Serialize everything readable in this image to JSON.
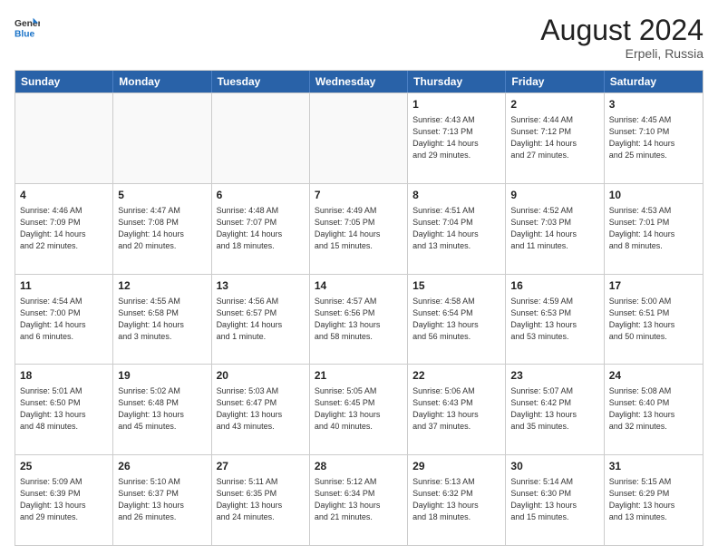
{
  "header": {
    "logo_line1": "General",
    "logo_line2": "Blue",
    "month": "August 2024",
    "location": "Erpeli, Russia"
  },
  "weekdays": [
    "Sunday",
    "Monday",
    "Tuesday",
    "Wednesday",
    "Thursday",
    "Friday",
    "Saturday"
  ],
  "rows": [
    [
      {
        "day": "",
        "text": "",
        "empty": true
      },
      {
        "day": "",
        "text": "",
        "empty": true
      },
      {
        "day": "",
        "text": "",
        "empty": true
      },
      {
        "day": "",
        "text": "",
        "empty": true
      },
      {
        "day": "1",
        "text": "Sunrise: 4:43 AM\nSunset: 7:13 PM\nDaylight: 14 hours\nand 29 minutes.",
        "empty": false
      },
      {
        "day": "2",
        "text": "Sunrise: 4:44 AM\nSunset: 7:12 PM\nDaylight: 14 hours\nand 27 minutes.",
        "empty": false
      },
      {
        "day": "3",
        "text": "Sunrise: 4:45 AM\nSunset: 7:10 PM\nDaylight: 14 hours\nand 25 minutes.",
        "empty": false
      }
    ],
    [
      {
        "day": "4",
        "text": "Sunrise: 4:46 AM\nSunset: 7:09 PM\nDaylight: 14 hours\nand 22 minutes.",
        "empty": false
      },
      {
        "day": "5",
        "text": "Sunrise: 4:47 AM\nSunset: 7:08 PM\nDaylight: 14 hours\nand 20 minutes.",
        "empty": false
      },
      {
        "day": "6",
        "text": "Sunrise: 4:48 AM\nSunset: 7:07 PM\nDaylight: 14 hours\nand 18 minutes.",
        "empty": false
      },
      {
        "day": "7",
        "text": "Sunrise: 4:49 AM\nSunset: 7:05 PM\nDaylight: 14 hours\nand 15 minutes.",
        "empty": false
      },
      {
        "day": "8",
        "text": "Sunrise: 4:51 AM\nSunset: 7:04 PM\nDaylight: 14 hours\nand 13 minutes.",
        "empty": false
      },
      {
        "day": "9",
        "text": "Sunrise: 4:52 AM\nSunset: 7:03 PM\nDaylight: 14 hours\nand 11 minutes.",
        "empty": false
      },
      {
        "day": "10",
        "text": "Sunrise: 4:53 AM\nSunset: 7:01 PM\nDaylight: 14 hours\nand 8 minutes.",
        "empty": false
      }
    ],
    [
      {
        "day": "11",
        "text": "Sunrise: 4:54 AM\nSunset: 7:00 PM\nDaylight: 14 hours\nand 6 minutes.",
        "empty": false
      },
      {
        "day": "12",
        "text": "Sunrise: 4:55 AM\nSunset: 6:58 PM\nDaylight: 14 hours\nand 3 minutes.",
        "empty": false
      },
      {
        "day": "13",
        "text": "Sunrise: 4:56 AM\nSunset: 6:57 PM\nDaylight: 14 hours\nand 1 minute.",
        "empty": false
      },
      {
        "day": "14",
        "text": "Sunrise: 4:57 AM\nSunset: 6:56 PM\nDaylight: 13 hours\nand 58 minutes.",
        "empty": false
      },
      {
        "day": "15",
        "text": "Sunrise: 4:58 AM\nSunset: 6:54 PM\nDaylight: 13 hours\nand 56 minutes.",
        "empty": false
      },
      {
        "day": "16",
        "text": "Sunrise: 4:59 AM\nSunset: 6:53 PM\nDaylight: 13 hours\nand 53 minutes.",
        "empty": false
      },
      {
        "day": "17",
        "text": "Sunrise: 5:00 AM\nSunset: 6:51 PM\nDaylight: 13 hours\nand 50 minutes.",
        "empty": false
      }
    ],
    [
      {
        "day": "18",
        "text": "Sunrise: 5:01 AM\nSunset: 6:50 PM\nDaylight: 13 hours\nand 48 minutes.",
        "empty": false
      },
      {
        "day": "19",
        "text": "Sunrise: 5:02 AM\nSunset: 6:48 PM\nDaylight: 13 hours\nand 45 minutes.",
        "empty": false
      },
      {
        "day": "20",
        "text": "Sunrise: 5:03 AM\nSunset: 6:47 PM\nDaylight: 13 hours\nand 43 minutes.",
        "empty": false
      },
      {
        "day": "21",
        "text": "Sunrise: 5:05 AM\nSunset: 6:45 PM\nDaylight: 13 hours\nand 40 minutes.",
        "empty": false
      },
      {
        "day": "22",
        "text": "Sunrise: 5:06 AM\nSunset: 6:43 PM\nDaylight: 13 hours\nand 37 minutes.",
        "empty": false
      },
      {
        "day": "23",
        "text": "Sunrise: 5:07 AM\nSunset: 6:42 PM\nDaylight: 13 hours\nand 35 minutes.",
        "empty": false
      },
      {
        "day": "24",
        "text": "Sunrise: 5:08 AM\nSunset: 6:40 PM\nDaylight: 13 hours\nand 32 minutes.",
        "empty": false
      }
    ],
    [
      {
        "day": "25",
        "text": "Sunrise: 5:09 AM\nSunset: 6:39 PM\nDaylight: 13 hours\nand 29 minutes.",
        "empty": false
      },
      {
        "day": "26",
        "text": "Sunrise: 5:10 AM\nSunset: 6:37 PM\nDaylight: 13 hours\nand 26 minutes.",
        "empty": false
      },
      {
        "day": "27",
        "text": "Sunrise: 5:11 AM\nSunset: 6:35 PM\nDaylight: 13 hours\nand 24 minutes.",
        "empty": false
      },
      {
        "day": "28",
        "text": "Sunrise: 5:12 AM\nSunset: 6:34 PM\nDaylight: 13 hours\nand 21 minutes.",
        "empty": false
      },
      {
        "day": "29",
        "text": "Sunrise: 5:13 AM\nSunset: 6:32 PM\nDaylight: 13 hours\nand 18 minutes.",
        "empty": false
      },
      {
        "day": "30",
        "text": "Sunrise: 5:14 AM\nSunset: 6:30 PM\nDaylight: 13 hours\nand 15 minutes.",
        "empty": false
      },
      {
        "day": "31",
        "text": "Sunrise: 5:15 AM\nSunset: 6:29 PM\nDaylight: 13 hours\nand 13 minutes.",
        "empty": false
      }
    ]
  ]
}
